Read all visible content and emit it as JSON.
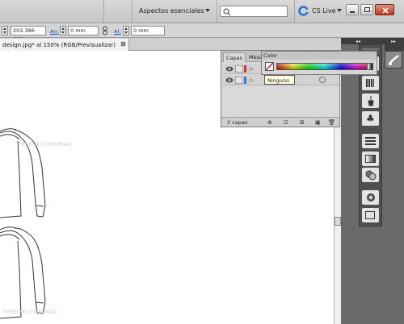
{
  "appbar": {
    "workspace": "Aspectos esenciales",
    "search_placeholder": "",
    "cs_live": "CS Live"
  },
  "control": {
    "x_value": "203.386 mm",
    "width_label": "An:",
    "width_value": "0 mm",
    "height_label": "Al:",
    "height_value": "0 mm"
  },
  "document": {
    "tab_title": "design.jpg* al 150% (RGB/Previsualizar)",
    "tab_close": "⊠",
    "watermark": "FREEVECTORIMAG"
  },
  "layers_panel": {
    "tabs": [
      "Capas",
      "Mesa",
      "Color"
    ],
    "status": "2 capas",
    "tooltip": "Ninguno"
  },
  "colors": {
    "accent": "#1e73d6",
    "panel": "#d9d9d9",
    "pasteboard": "#6a6a6a"
  }
}
